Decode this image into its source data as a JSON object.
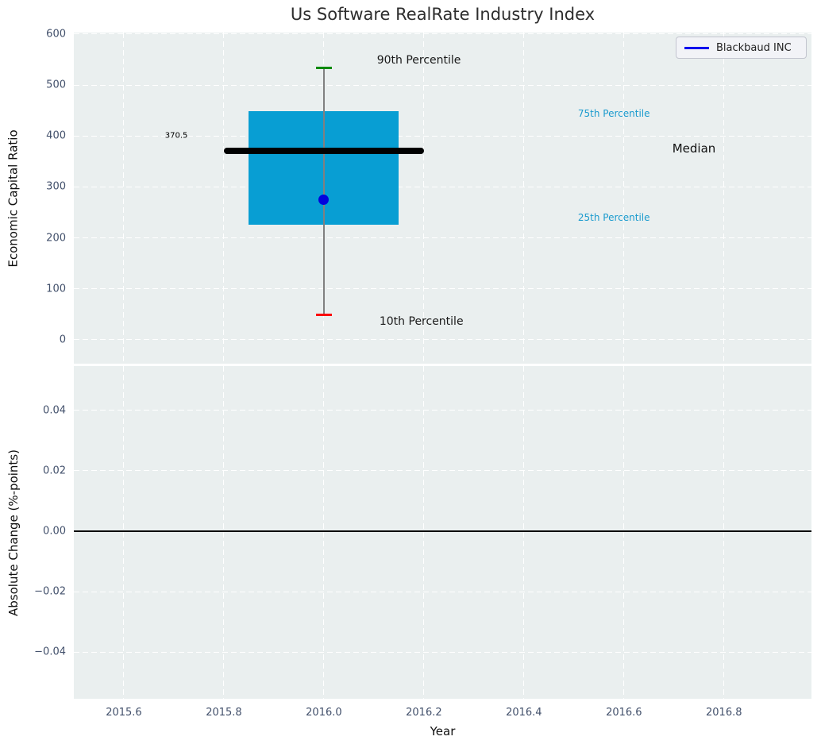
{
  "figure": {
    "background": "#ffffff",
    "axes_background": "#eaefef",
    "grid_color": "#ffffff",
    "tick_label_color": "#42506b"
  },
  "chart_data": [
    {
      "type": "box",
      "title": "Us Software RealRate Industry Index",
      "ylabel": "Economic Capital Ratio",
      "xlim": [
        2015.5,
        2016.975
      ],
      "ylim": [
        -47,
        603
      ],
      "grid": true,
      "yticks": [
        {
          "v": 0,
          "label": "0"
        },
        {
          "v": 100,
          "label": "100"
        },
        {
          "v": 200,
          "label": "200"
        },
        {
          "v": 300,
          "label": "300"
        },
        {
          "v": 400,
          "label": "400"
        },
        {
          "v": 500,
          "label": "500"
        },
        {
          "v": 600,
          "label": "600"
        }
      ],
      "xtick_values": [
        2015.6,
        2015.8,
        2016.0,
        2016.2,
        2016.4,
        2016.6,
        2016.8
      ],
      "legend": {
        "label": "Blackbaud INC",
        "line_color": "#0000ee",
        "position": "upper right"
      },
      "box": {
        "x_center": 2016.0,
        "box_left": 2015.85,
        "box_right": 2016.15,
        "p10": 49,
        "p25": 226,
        "median": 370.5,
        "p75": 448,
        "p90": 533,
        "company_value": 275,
        "median_line_left": 2015.8,
        "median_line_right": 2016.2,
        "cap_halfwidth": 0.016,
        "box_color": "#089ed3",
        "median_color": "#000000",
        "whisker_color": "#808080",
        "p90_cap_color": "#0a8a0a",
        "p10_cap_color": "#fb0007",
        "company_point_color": "#0202dd"
      },
      "annotations": [
        {
          "text": "90th Percentile",
          "x": 2016.19,
          "y": 548,
          "color": "#1a1a1a",
          "size": 14
        },
        {
          "text": "75th Percentile",
          "x": 2016.58,
          "y": 444,
          "color": "#1b9bce",
          "size": 12
        },
        {
          "text": "Median",
          "x": 2016.74,
          "y": 376,
          "color": "#111111",
          "size": 15
        },
        {
          "text": "370.5",
          "x": 2015.705,
          "y": 401,
          "color": "#000000",
          "size": 10
        },
        {
          "text": "25th Percentile",
          "x": 2016.58,
          "y": 240,
          "color": "#1b9bce",
          "size": 12
        },
        {
          "text": "10th Percentile",
          "x": 2016.195,
          "y": 36,
          "color": "#1a1a1a",
          "size": 14
        }
      ]
    },
    {
      "type": "line",
      "ylabel": "Absolute Change (%-points)",
      "xlabel": "Year",
      "xlim": [
        2015.5,
        2016.975
      ],
      "ylim": [
        -0.0555,
        0.0547
      ],
      "grid": true,
      "yticks": [
        {
          "v": 0.04,
          "label": "0.04"
        },
        {
          "v": 0.02,
          "label": "0.02"
        },
        {
          "v": 0.0,
          "label": "0.00"
        },
        {
          "v": -0.02,
          "label": "−0.02"
        },
        {
          "v": -0.04,
          "label": "−0.04"
        }
      ],
      "xticks": [
        {
          "v": 2015.6,
          "label": "2015.6"
        },
        {
          "v": 2015.8,
          "label": "2015.8"
        },
        {
          "v": 2016.0,
          "label": "2016.0"
        },
        {
          "v": 2016.2,
          "label": "2016.2"
        },
        {
          "v": 2016.4,
          "label": "2016.4"
        },
        {
          "v": 2016.6,
          "label": "2016.6"
        },
        {
          "v": 2016.8,
          "label": "2016.8"
        }
      ],
      "zero_line": {
        "y": 0.0,
        "color": "#000000"
      },
      "series": []
    }
  ]
}
